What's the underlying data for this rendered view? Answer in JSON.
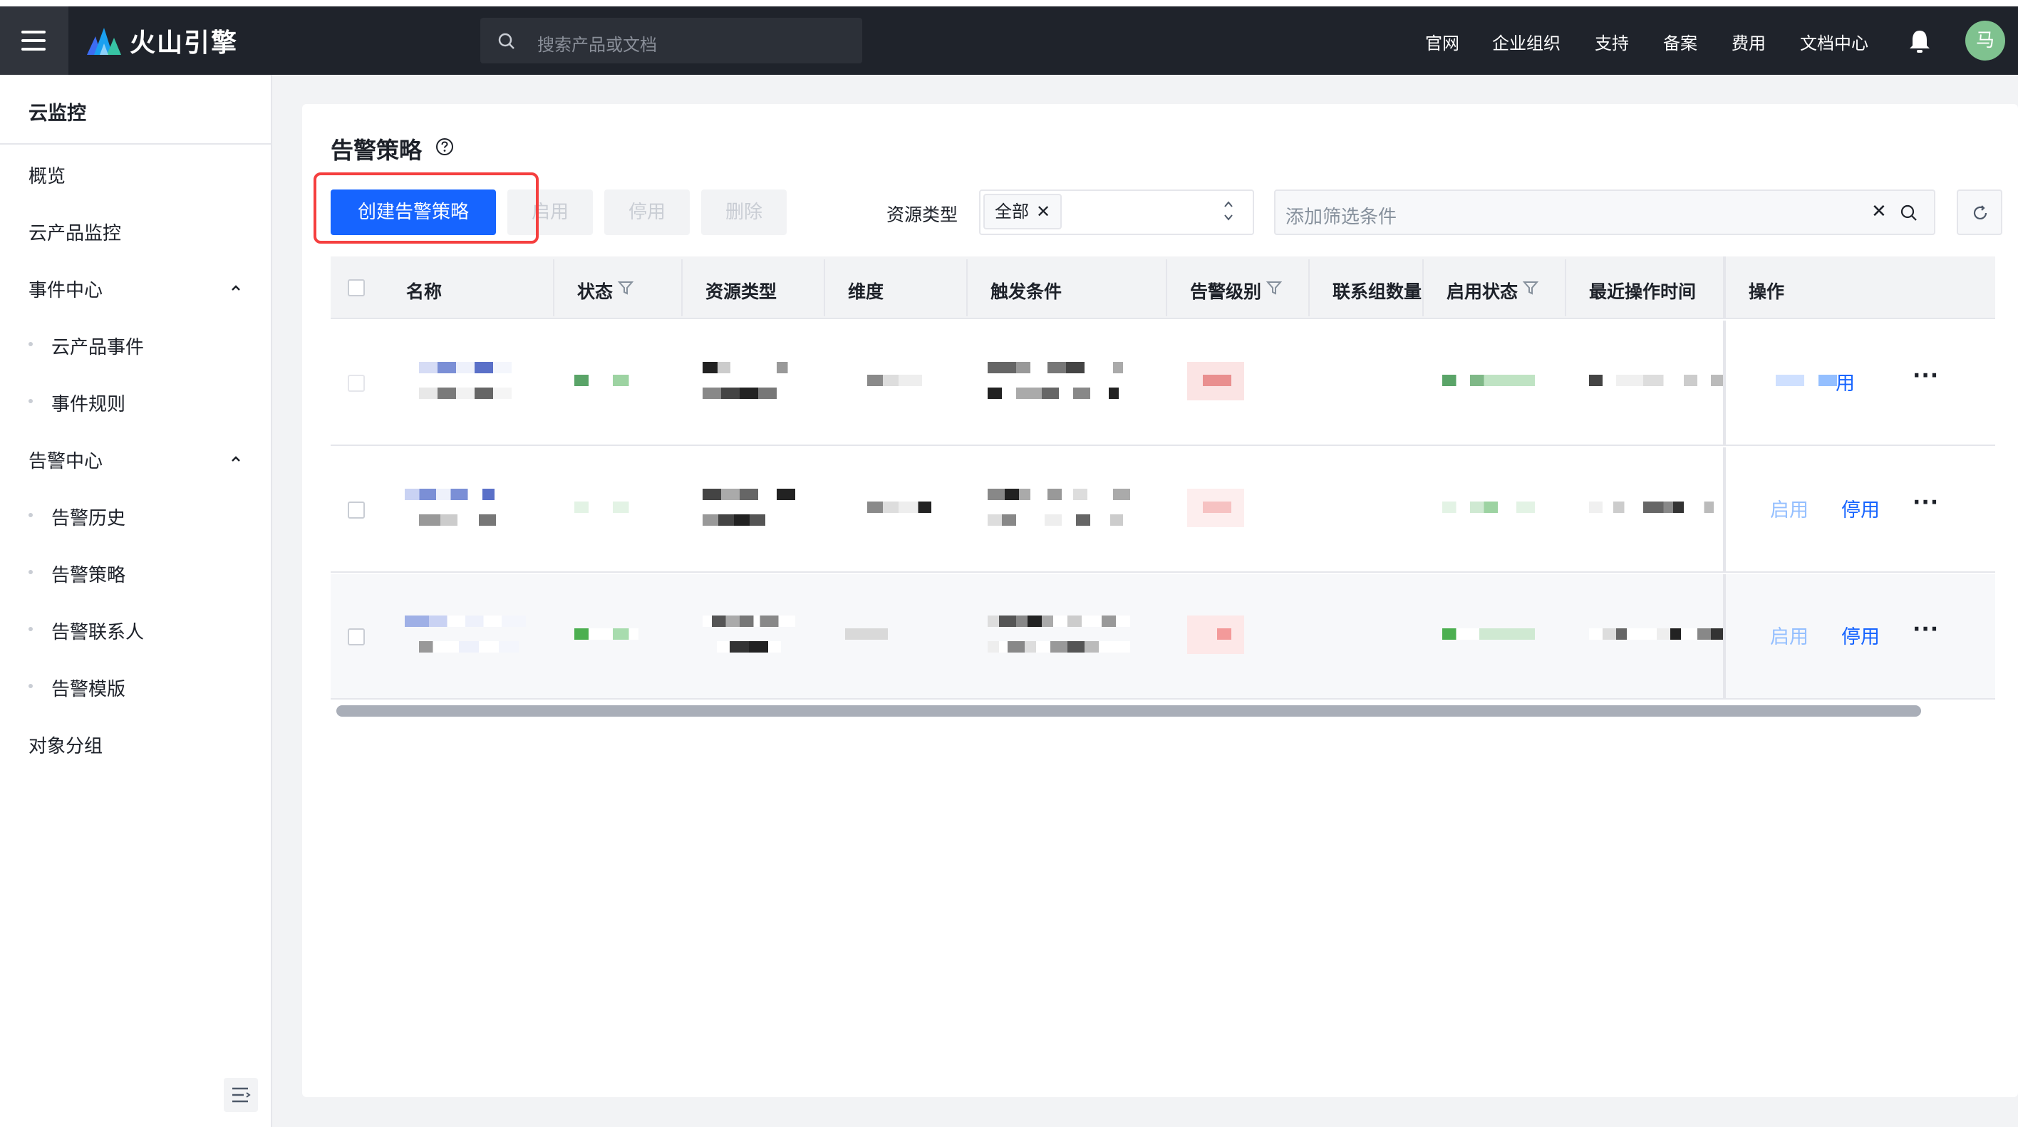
{
  "header": {
    "brand": "火山引擎",
    "search_placeholder": "搜索产品或文档",
    "nav": [
      "官网",
      "企业组织",
      "支持",
      "备案",
      "费用",
      "文档中心"
    ],
    "avatar_text": "马"
  },
  "sidebar": {
    "title": "云监控",
    "items": [
      {
        "label": "概览"
      },
      {
        "label": "云产品监控"
      },
      {
        "label": "事件中心"
      },
      {
        "label": "云产品事件"
      },
      {
        "label": "事件规则"
      },
      {
        "label": "告警中心"
      },
      {
        "label": "告警历史"
      },
      {
        "label": "告警策略"
      },
      {
        "label": "告警联系人"
      },
      {
        "label": "告警模版"
      },
      {
        "label": "对象分组"
      }
    ]
  },
  "main": {
    "title": "告警策略",
    "buttons": {
      "create": "创建告警策略",
      "enable": "启用",
      "disable": "停用",
      "delete": "删除"
    },
    "filter": {
      "resource_label": "资源类型",
      "resource_tag": "全部",
      "condition_placeholder": "添加筛选条件"
    },
    "table": {
      "columns": [
        "名称",
        "状态",
        "资源类型",
        "维度",
        "触发条件",
        "告警级别",
        "联系组数量",
        "启用状态",
        "最近操作时间",
        "操作"
      ],
      "row_actions": {
        "enable": "启用",
        "disable": "停用",
        "more": "···"
      },
      "row_count": 3
    }
  },
  "colors": {
    "primary": "#1664ff",
    "header_bg": "#1f232b",
    "highlight": "#f53f3f",
    "status_green": "#4caf50"
  }
}
